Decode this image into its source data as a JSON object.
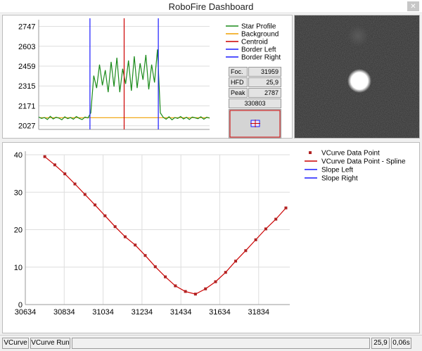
{
  "window": {
    "title": "RoboFire Dashboard"
  },
  "icons": {
    "close": "close-icon"
  },
  "profile_chart": {
    "type": "line",
    "y_ticks": [
      "2747",
      "2603",
      "2459",
      "2315",
      "2171",
      "2027"
    ],
    "ylim": [
      2000,
      2765
    ],
    "legend": [
      "Star Profile",
      "Background",
      "Centroid",
      "Border Left",
      "Border Right"
    ],
    "colors": {
      "star_profile": "#1a8a1a",
      "background": "#f0a000",
      "centroid": "#cc0000",
      "border_left": "#1a1aff",
      "border_right": "#1a1aff"
    },
    "background_level": 2085,
    "border_left_x": 18,
    "centroid_x": 30,
    "border_right_x": 42,
    "x_range": [
      0,
      60
    ],
    "profile_y": [
      2090,
      2080,
      2086,
      2072,
      2095,
      2076,
      2088,
      2082,
      2070,
      2092,
      2078,
      2086,
      2074,
      2094,
      2080,
      2072,
      2090,
      2083,
      2120,
      2390,
      2300,
      2470,
      2320,
      2430,
      2270,
      2490,
      2310,
      2520,
      2270,
      2440,
      2330,
      2500,
      2280,
      2530,
      2300,
      2480,
      2360,
      2540,
      2290,
      2470,
      2340,
      2580,
      2120,
      2088,
      2074,
      2092,
      2070,
      2086,
      2080,
      2094,
      2076,
      2088,
      2072,
      2090,
      2084,
      2078,
      2092,
      2074,
      2088,
      2082
    ]
  },
  "focus_info": {
    "rows": [
      {
        "label": "Foc.",
        "value": "31959"
      },
      {
        "label": "HFD",
        "value": "25,9"
      },
      {
        "label": "Peak",
        "value": "2787"
      }
    ],
    "total": "330803"
  },
  "vcurve_chart": {
    "type": "line",
    "x_ticks": [
      "30634",
      "30834",
      "31034",
      "31234",
      "31434",
      "31634",
      "31834"
    ],
    "x_tick_values": [
      30634,
      30834,
      31034,
      31234,
      31434,
      31634,
      31834
    ],
    "y_ticks": [
      "40",
      "30",
      "20",
      "10",
      "0"
    ],
    "y_tick_values": [
      40,
      30,
      20,
      10,
      0
    ],
    "xlim": [
      30634,
      31994
    ],
    "ylim": [
      0,
      40
    ],
    "legend": [
      "VCurve Data Point",
      "VCurve Data Point - Spline",
      "Slope Left",
      "Slope Right"
    ],
    "colors": {
      "data_point": "#b22222",
      "spline": "#cc0000",
      "slope_left": "#1a1aff",
      "slope_right": "#1a1aff"
    },
    "x": [
      30734,
      30794,
      30854,
      30914,
      30974,
      31034,
      31094,
      31154,
      31214,
      31274,
      31334,
      31394,
      31454,
      31514,
      31574,
      31634,
      31694,
      31754,
      31814,
      31874,
      31934
    ],
    "y": [
      39.5,
      37.3,
      34.9,
      32.2,
      29.4,
      26.6,
      23.7,
      20.8,
      18.1,
      15.9,
      13.1,
      10.1,
      7.4,
      5.0,
      3.5,
      2.8,
      4.2,
      6.1,
      8.6,
      11.6,
      14.4,
      17.3,
      20.2,
      22.8,
      25.8
    ]
  },
  "statusbar": {
    "buttons": [
      "VCurve",
      "VCurve Run"
    ],
    "hfd": "25,9",
    "time": "0,06s"
  }
}
